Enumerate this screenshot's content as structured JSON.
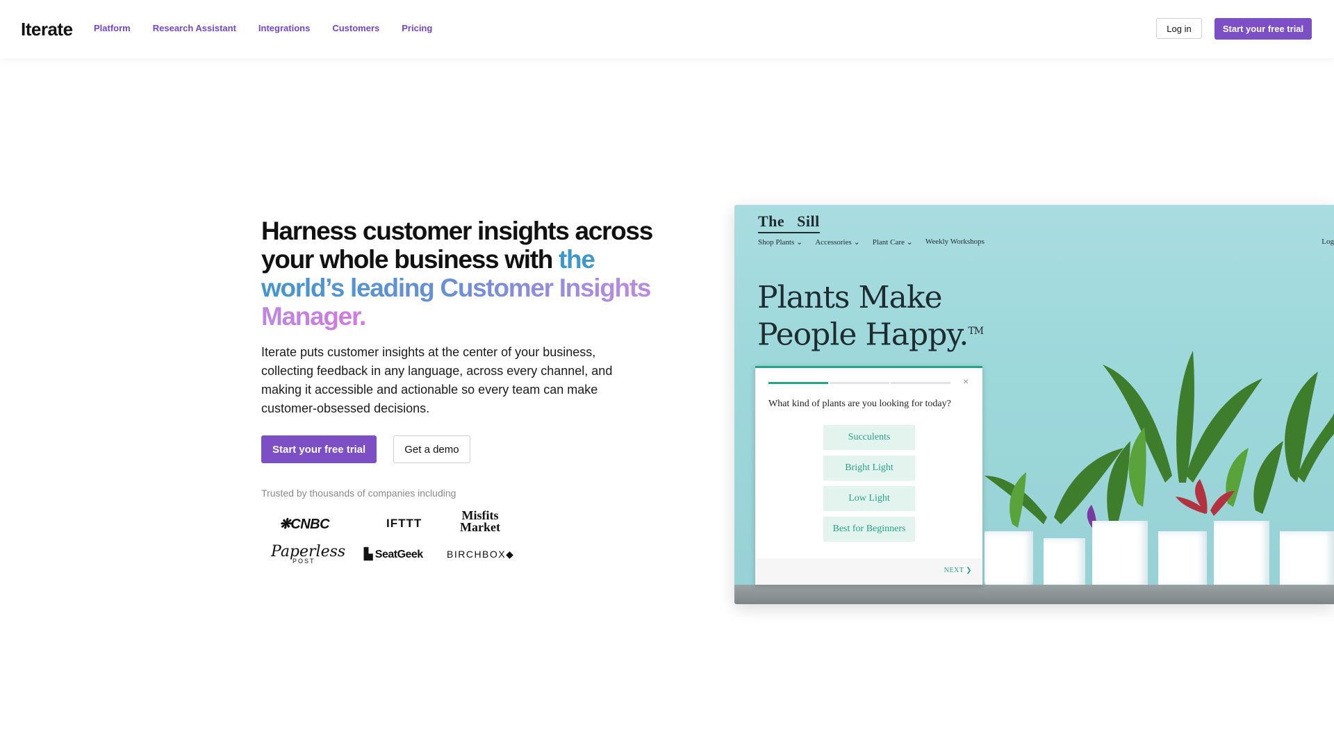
{
  "header": {
    "logo": "Iterate",
    "nav": [
      "Platform",
      "Research Assistant",
      "Integrations",
      "Customers",
      "Pricing"
    ],
    "login_label": "Log in",
    "trial_label": "Start your free trial"
  },
  "hero": {
    "headline_line1": "Harness customer insights across your whole business with",
    "headline_gradient": "the world’s leading Customer Insights Manager.",
    "subcopy": "Iterate puts customer insights at the center of your business, collecting feedback in any language, across every channel, and making it accessible and actionable so every team can make customer-obsessed decisions.",
    "cta_primary": "Start your free trial",
    "cta_secondary": "Get a demo",
    "trusted": "Trusted by thousands of companies including",
    "customer_logos": {
      "cnbc": "CNBC",
      "ifttt": "IFTTT",
      "misfits": "Misfits Market",
      "paperless": "Paperless",
      "paperless_sub": "POST",
      "seatgeek": "SeatGeek",
      "birchbox": "BIRCHBOX"
    }
  },
  "preview": {
    "brand": "The   Sill",
    "nav": [
      "Shop Plants ⌄",
      "Accessories ⌄",
      "Plant Care ⌄",
      "Weekly Workshops"
    ],
    "nav_right": "Log",
    "headline_line1": "Plants Make",
    "headline_line2": "People Happy.",
    "trademark": "TM",
    "survey": {
      "question": "What kind of plants are you looking for today?",
      "options": [
        "Succulents",
        "Bright Light",
        "Low Light",
        "Best for Beginners"
      ],
      "close": "×",
      "next": "NEXT ❯",
      "progress_steps": 3,
      "progress_current": 1
    }
  },
  "colors": {
    "accent": "#7c4fc4",
    "survey_accent": "#26a386",
    "panel_bg": "#9dd8db"
  }
}
